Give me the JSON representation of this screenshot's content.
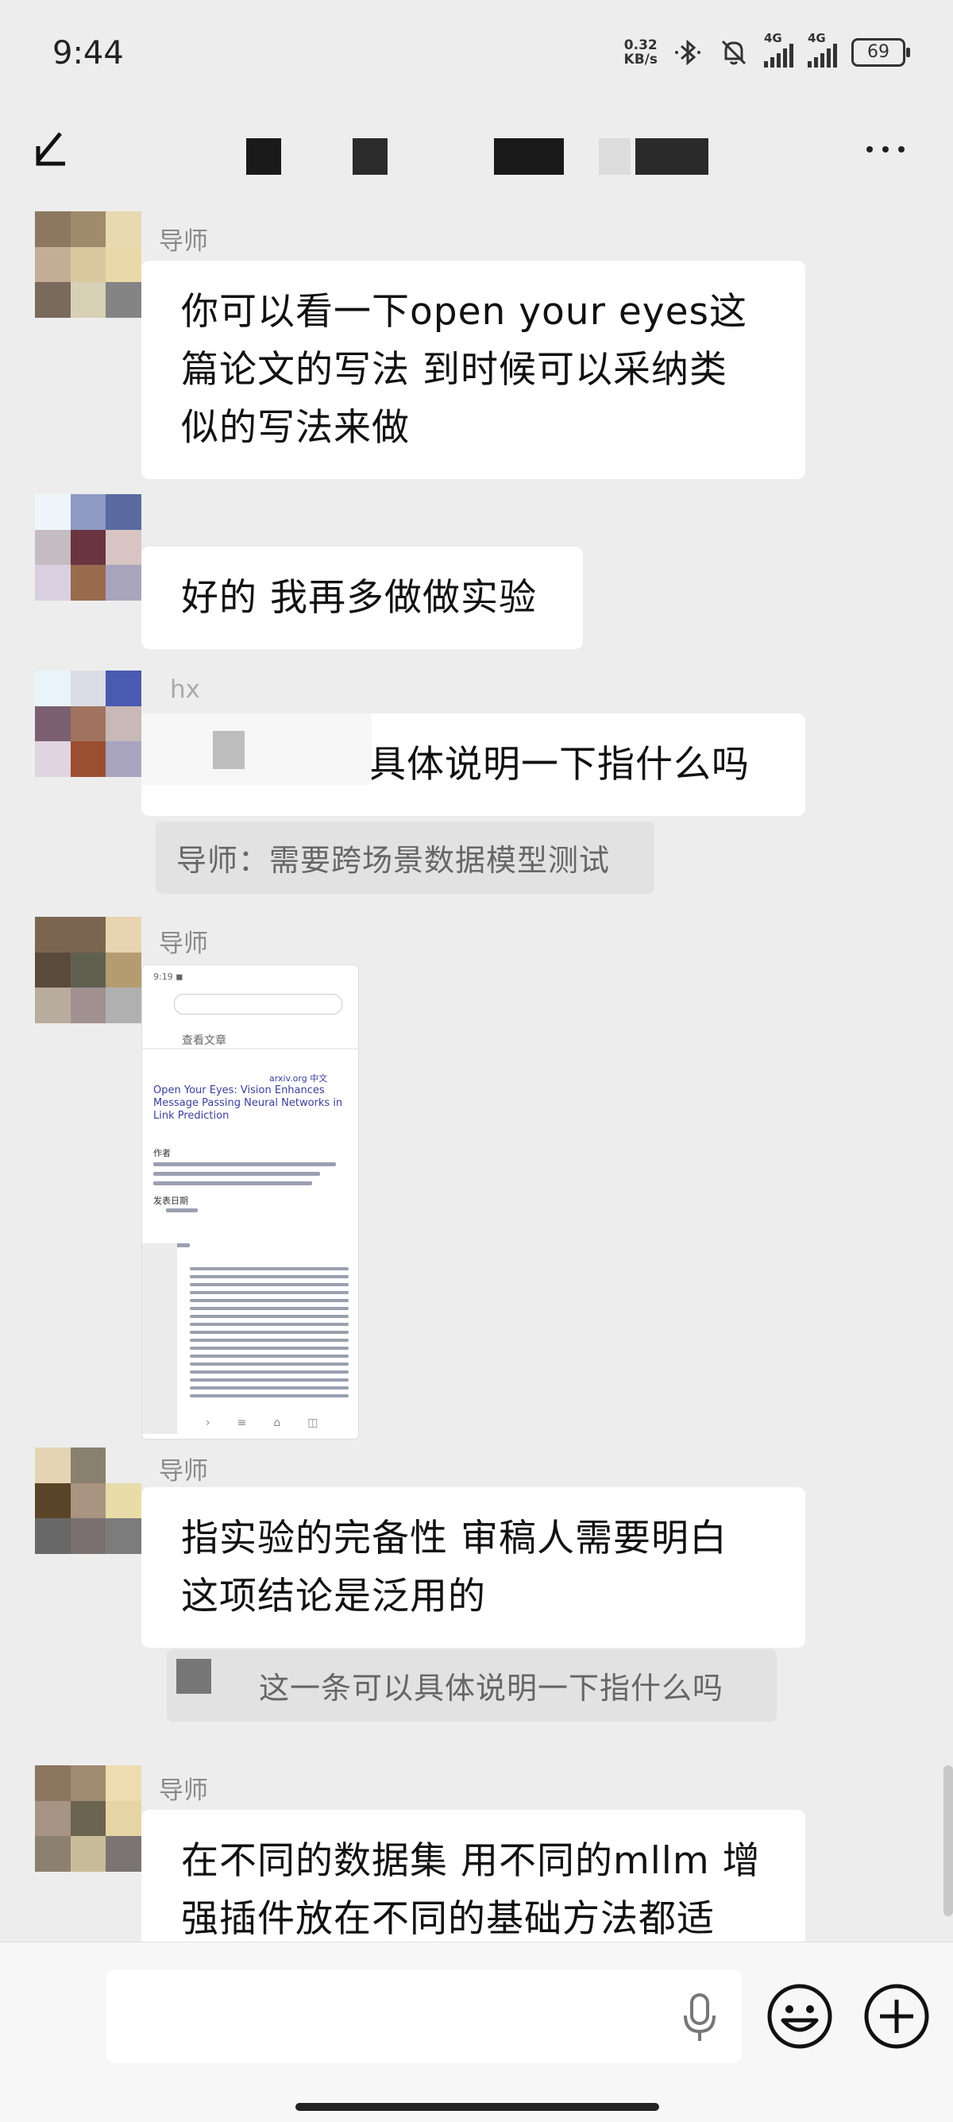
{
  "status": {
    "time": "9:44",
    "net_speed_top": "0.32",
    "net_speed_bottom": "KB/s",
    "signal_1": "4G",
    "signal_2": "4G",
    "battery": "69"
  },
  "colors": {
    "background": "#ededed",
    "bubble": "#ffffff",
    "quote_bg": "#e2e2e2",
    "muted_text": "#8a8a8a"
  },
  "messages": [
    {
      "sender": "导师",
      "text": "你可以看一下open your eyes这篇论文的写法 到时候可以采纳类似的写法来做",
      "lines": [
        "你可以看一下open your eyes这",
        "篇论文的写法 到时候可以采纳类",
        "似的写法来做"
      ]
    },
    {
      "sender": "",
      "text": "好的 我再多做做实验"
    },
    {
      "sender": "hx",
      "text": "这一条可以具体说明一下指什么吗",
      "visible_text": "可以具体说明一下指什么吗",
      "quote": "导师：需要跨场景数据模型测试"
    },
    {
      "sender": "导师",
      "type": "image",
      "image": {
        "label": "查看文章",
        "site": "arxiv.org 中文",
        "title": "Open Your Eyes: Vision Enhances Message Passing Neural Networks in Link Prediction",
        "authors_label": "作者",
        "date_label": "发表日期"
      }
    },
    {
      "sender": "导师",
      "lines": [
        "指实验的完备性 审稿人需要明白",
        "这项结论是泛用的"
      ],
      "quote": "这一条可以具体说明一下指什么吗"
    },
    {
      "sender": "导师",
      "lines": [
        "在不同的数据集 用不同的mllm 增",
        "强插件放在不同的基础方法都适"
      ]
    }
  ],
  "input": {
    "placeholder": "",
    "icons": [
      "mic-icon",
      "emoji-icon",
      "plus-icon"
    ]
  },
  "icons": {
    "back": "back-arrow-icon",
    "more": "more-icon",
    "bluetooth": "bluetooth-icon",
    "mute": "mute-bell-icon"
  }
}
